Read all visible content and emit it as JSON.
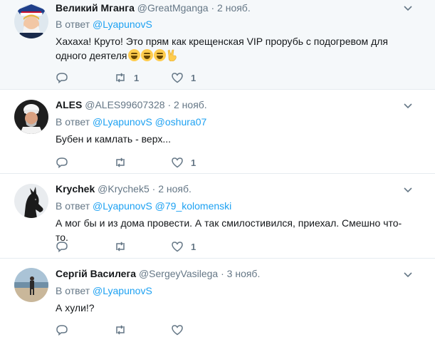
{
  "reply_prefix": "В ответ",
  "tweets": [
    {
      "name": "Великий Мганга",
      "handle": "@GreatMganga",
      "sep": "·",
      "time": "2 нояб.",
      "mentions": [
        "@LyapunovS"
      ],
      "text": "Хахаха! Круто! Это прям как крещенская VIP прорубь с подогревом для одного деятеля",
      "emoji": [
        "grinning-sweat-emoji",
        "grinning-sweat-emoji",
        "grinning-sweat-emoji",
        "victory-hand-emoji"
      ],
      "retweets": "1",
      "likes": "1",
      "replies": "",
      "highlighted": true
    },
    {
      "name": "ALES",
      "handle": "@ALES99607328",
      "sep": "·",
      "time": "2 нояб.",
      "mentions": [
        "@LyapunovS",
        "@oshura07"
      ],
      "text": "Бубен и камлать - верх...",
      "retweets": "",
      "likes": "1",
      "replies": ""
    },
    {
      "name": "Krychek",
      "handle": "@Krychek5",
      "sep": "·",
      "time": "2 нояб.",
      "mentions": [
        "@LyapunovS",
        "@79_kolomenski"
      ],
      "text": "А мог бы и из дома провести. А так смилостивился, приехал. Смешно что-то.",
      "retweets": "",
      "likes": "1",
      "replies": ""
    },
    {
      "name": "Сергій Василега",
      "handle": "@SergeyVasilega",
      "sep": "·",
      "time": "3 нояб.",
      "mentions": [
        "@LyapunovS"
      ],
      "text": "А хули!?",
      "retweets": "",
      "likes": "",
      "replies": ""
    }
  ],
  "icons": {
    "reply": "reply-icon",
    "retweet": "retweet-icon",
    "like": "heart-icon",
    "more": "chevron-down-icon"
  },
  "colors": {
    "accent": "#1da1f2",
    "secondary": "#657786",
    "highlight_bg": "#f5f8fa",
    "divider": "#e6ecf0"
  }
}
